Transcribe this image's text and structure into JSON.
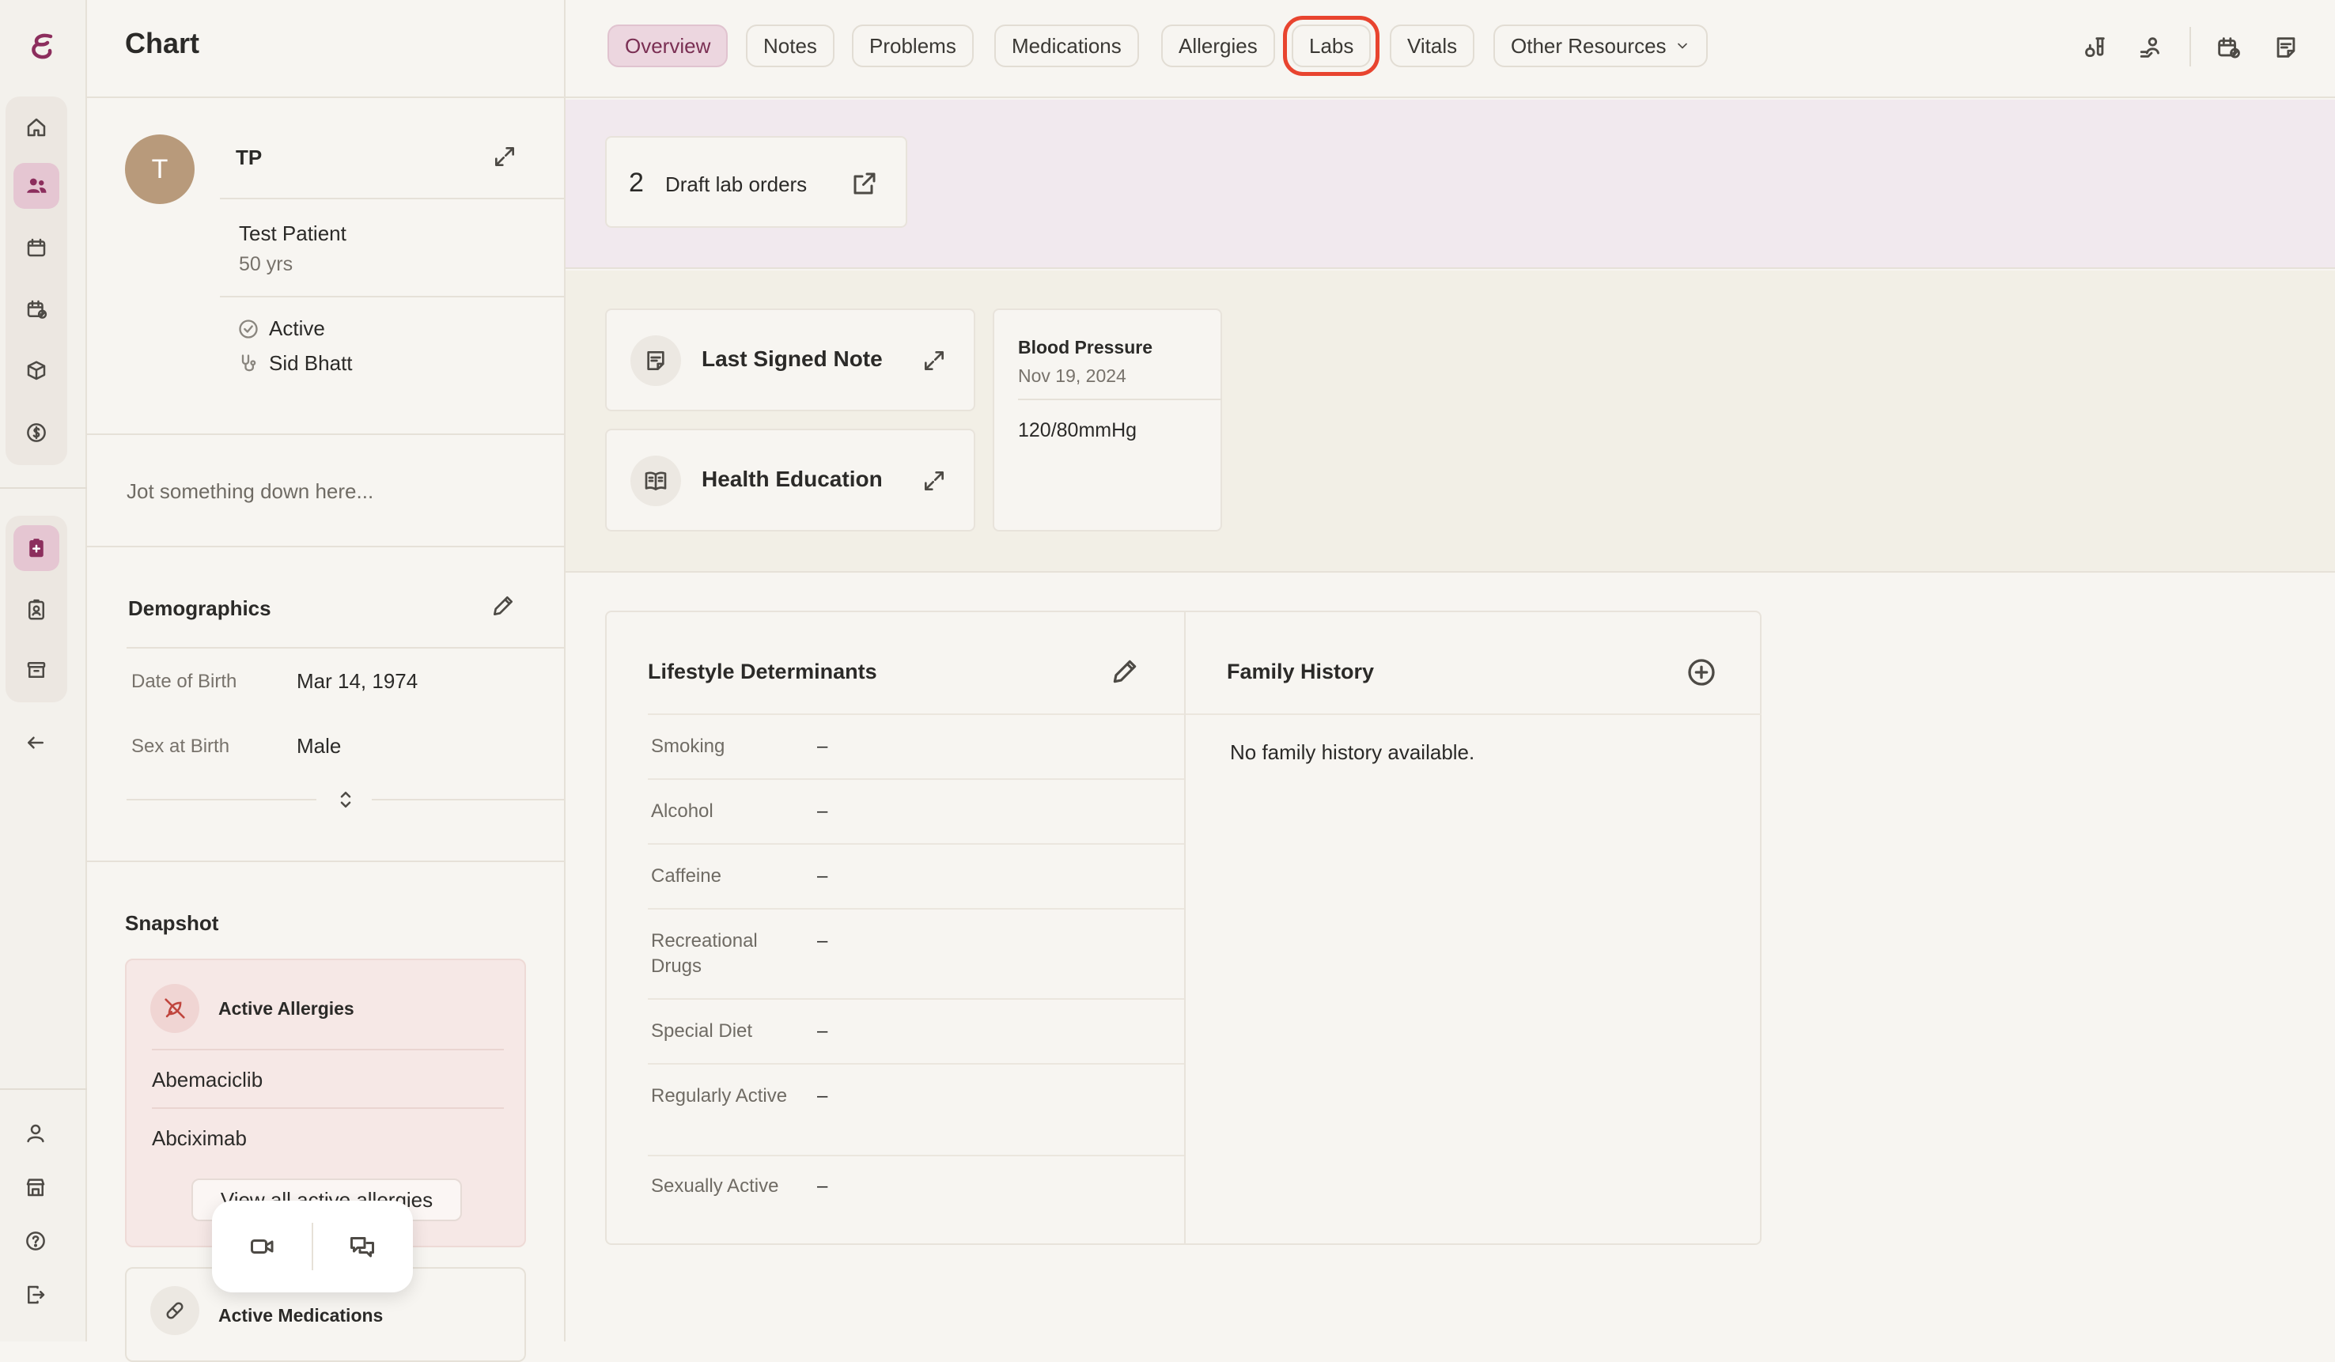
{
  "app": {
    "title": "Chart",
    "accent": "#8c2e5d",
    "highlight": "#e8442f"
  },
  "rail": {
    "items": [
      {
        "icon": "home-icon"
      },
      {
        "icon": "patients-icon",
        "active": true
      },
      {
        "icon": "calendar-icon"
      },
      {
        "icon": "calendar-check-icon"
      },
      {
        "icon": "box-icon"
      },
      {
        "icon": "dollar-icon"
      },
      {
        "icon": "chart-clipboard-icon",
        "active": true
      },
      {
        "icon": "badge-icon"
      },
      {
        "icon": "archive-icon"
      },
      {
        "icon": "back-arrow-icon"
      },
      {
        "icon": "user-icon"
      },
      {
        "icon": "store-icon"
      },
      {
        "icon": "help-icon"
      },
      {
        "icon": "logout-icon"
      }
    ]
  },
  "patient": {
    "avatar_letter": "T",
    "initials": "TP",
    "name": "Test Patient",
    "age": "50 yrs",
    "status": "Active",
    "provider": "Sid Bhatt",
    "jot_placeholder": "Jot something down here..."
  },
  "demographics": {
    "title": "Demographics",
    "rows": [
      {
        "label": "Date of Birth",
        "value": "Mar 14, 1974"
      },
      {
        "label": "Sex at Birth",
        "value": "Male"
      }
    ]
  },
  "snapshot": {
    "title": "Snapshot",
    "allergies_title": "Active Allergies",
    "allergies": [
      "Abemaciclib",
      "Abciximab"
    ],
    "view_all_label": "View all active allergies",
    "medications_title": "Active Medications"
  },
  "tabs": [
    {
      "label": "Overview"
    },
    {
      "label": "Notes"
    },
    {
      "label": "Problems"
    },
    {
      "label": "Medications"
    },
    {
      "label": "Allergies"
    },
    {
      "label": "Labs"
    },
    {
      "label": "Vitals"
    },
    {
      "label": "Other Resources"
    }
  ],
  "selected_tab": "Overview",
  "highlighted_tab": "Labs",
  "draft_labs": {
    "count": "2",
    "label": "Draft lab orders"
  },
  "widgets": {
    "last_signed_note": "Last Signed Note",
    "health_education": "Health Education",
    "blood_pressure": {
      "title": "Blood Pressure",
      "date": "Nov 19, 2024",
      "value": "120/80mmHg"
    }
  },
  "lifestyle": {
    "title": "Lifestyle Determinants",
    "rows": [
      {
        "label": "Smoking",
        "value": "–"
      },
      {
        "label": "Alcohol",
        "value": "–"
      },
      {
        "label": "Caffeine",
        "value": "–"
      },
      {
        "label": "Recreational Drugs",
        "value": "–"
      },
      {
        "label": "Special Diet",
        "value": "–"
      },
      {
        "label": "Regularly Active",
        "value": "–"
      },
      {
        "label": "Sexually Active",
        "value": "–"
      }
    ]
  },
  "family_history": {
    "title": "Family History",
    "empty_text": "No family history available."
  }
}
